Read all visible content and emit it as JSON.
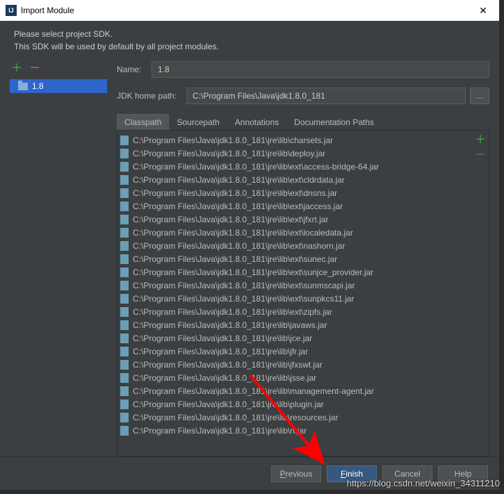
{
  "titlebar": {
    "title": "Import Module"
  },
  "instructions": {
    "line1": "Please select project SDK.",
    "line2": "This SDK will be used by default by all project modules."
  },
  "sidebar": {
    "items": [
      {
        "label": "1.8"
      }
    ]
  },
  "form": {
    "name_label": "Name:",
    "name_value": "1.8",
    "jdk_home_label": "JDK home path:",
    "jdk_home_value": "C:\\Program Files\\Java\\jdk1.8.0_181",
    "browse_label": "..."
  },
  "tabs": [
    {
      "label": "Classpath",
      "active": true
    },
    {
      "label": "Sourcepath"
    },
    {
      "label": "Annotations"
    },
    {
      "label": "Documentation Paths"
    }
  ],
  "classpath": [
    "C:\\Program Files\\Java\\jdk1.8.0_181\\jre\\lib\\charsets.jar",
    "C:\\Program Files\\Java\\jdk1.8.0_181\\jre\\lib\\deploy.jar",
    "C:\\Program Files\\Java\\jdk1.8.0_181\\jre\\lib\\ext\\access-bridge-64.jar",
    "C:\\Program Files\\Java\\jdk1.8.0_181\\jre\\lib\\ext\\cldrdata.jar",
    "C:\\Program Files\\Java\\jdk1.8.0_181\\jre\\lib\\ext\\dnsns.jar",
    "C:\\Program Files\\Java\\jdk1.8.0_181\\jre\\lib\\ext\\jaccess.jar",
    "C:\\Program Files\\Java\\jdk1.8.0_181\\jre\\lib\\ext\\jfxrt.jar",
    "C:\\Program Files\\Java\\jdk1.8.0_181\\jre\\lib\\ext\\localedata.jar",
    "C:\\Program Files\\Java\\jdk1.8.0_181\\jre\\lib\\ext\\nashorn.jar",
    "C:\\Program Files\\Java\\jdk1.8.0_181\\jre\\lib\\ext\\sunec.jar",
    "C:\\Program Files\\Java\\jdk1.8.0_181\\jre\\lib\\ext\\sunjce_provider.jar",
    "C:\\Program Files\\Java\\jdk1.8.0_181\\jre\\lib\\ext\\sunmscapi.jar",
    "C:\\Program Files\\Java\\jdk1.8.0_181\\jre\\lib\\ext\\sunpkcs11.jar",
    "C:\\Program Files\\Java\\jdk1.8.0_181\\jre\\lib\\ext\\zipfs.jar",
    "C:\\Program Files\\Java\\jdk1.8.0_181\\jre\\lib\\javaws.jar",
    "C:\\Program Files\\Java\\jdk1.8.0_181\\jre\\lib\\jce.jar",
    "C:\\Program Files\\Java\\jdk1.8.0_181\\jre\\lib\\jfr.jar",
    "C:\\Program Files\\Java\\jdk1.8.0_181\\jre\\lib\\jfxswt.jar",
    "C:\\Program Files\\Java\\jdk1.8.0_181\\jre\\lib\\jsse.jar",
    "C:\\Program Files\\Java\\jdk1.8.0_181\\jre\\lib\\management-agent.jar",
    "C:\\Program Files\\Java\\jdk1.8.0_181\\jre\\lib\\plugin.jar",
    "C:\\Program Files\\Java\\jdk1.8.0_181\\jre\\lib\\resources.jar",
    "C:\\Program Files\\Java\\jdk1.8.0_181\\jre\\lib\\rt.jar"
  ],
  "buttons": {
    "previous": "Previous",
    "finish": "Finish",
    "cancel": "Cancel",
    "help": "Help"
  },
  "watermark": "https://blog.csdn.net/weixin_34311210"
}
